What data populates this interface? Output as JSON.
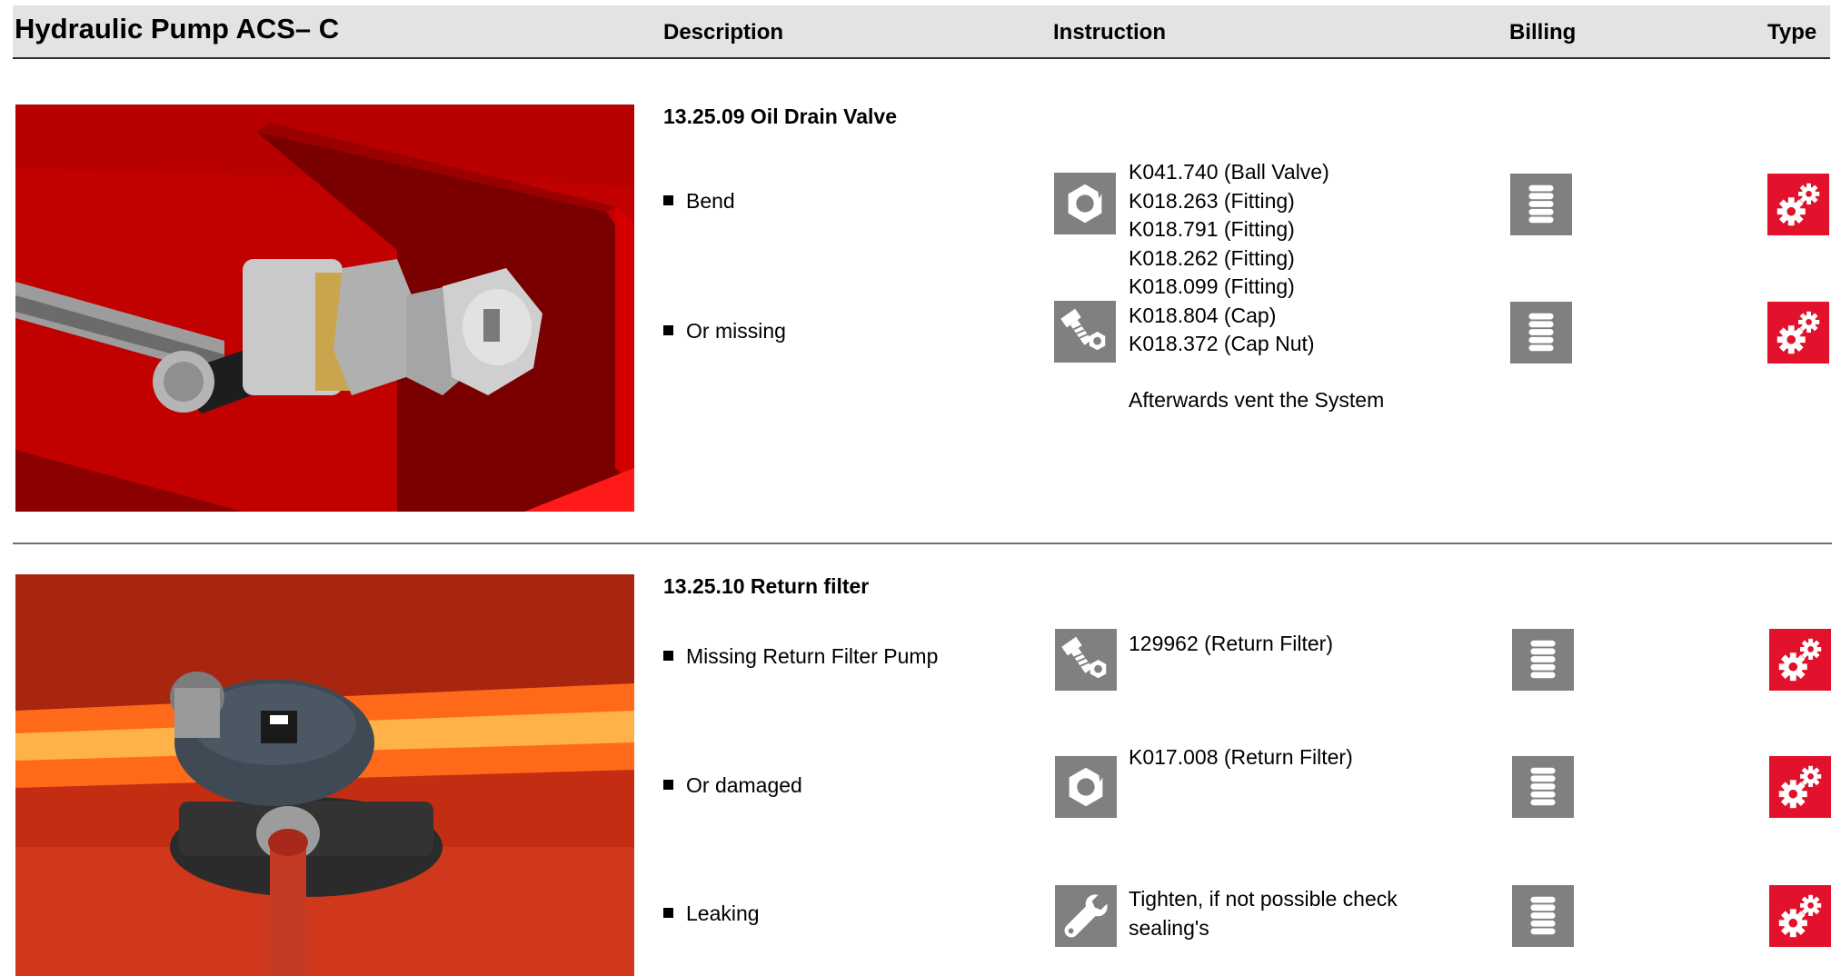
{
  "header": {
    "title": "Hydraulic Pump ACS– C",
    "description": "Description",
    "instruction": "Instruction",
    "billing": "Billing",
    "type": "Type"
  },
  "sections": [
    {
      "title": "13.25.09 Oil Drain Valve",
      "bullets": [
        "Bend",
        "Or missing"
      ],
      "instruction_icons": [
        "nut-icon",
        "bolt-nut-icon"
      ],
      "parts": [
        "K041.740 (Ball Valve)",
        "K018.263 (Fitting)",
        "K018.791 (Fitting)",
        "K018.262 (Fitting)",
        "K018.099 (Fitting)",
        "K018.804 (Cap)",
        "K018.372 (Cap Nut)"
      ],
      "note": "Afterwards vent the System"
    },
    {
      "title": "13.25.10 Return filter",
      "bullets": [
        "Missing Return Filter Pump",
        "Or damaged",
        "Leaking"
      ],
      "instruction_icons": [
        "bolt-nut-icon",
        "nut-icon",
        "wrench-icon"
      ],
      "instructions": [
        "129962 (Return Filter)",
        "K017.008 (Return Filter)",
        "Tighten, if not possible check",
        "sealing's"
      ]
    }
  ],
  "icons": {
    "billing": "coin-stack-icon",
    "type": "gears-icon"
  },
  "colors": {
    "header_bg": "#e3e3e3",
    "icon_grey": "#808080",
    "type_red": "#e3122c"
  }
}
